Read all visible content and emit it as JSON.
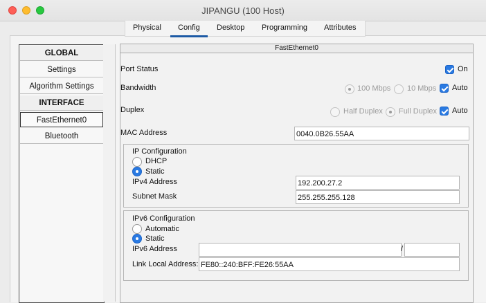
{
  "window": {
    "title": "JIPANGU (100 Host)"
  },
  "tabs": [
    {
      "label": "Physical"
    },
    {
      "label": "Config"
    },
    {
      "label": "Desktop"
    },
    {
      "label": "Programming"
    },
    {
      "label": "Attributes"
    }
  ],
  "active_tab": "Config",
  "nav": {
    "global_header": "GLOBAL",
    "settings": "Settings",
    "algorithm_settings": "Algorithm Settings",
    "interface_header": "INTERFACE",
    "fastethernet": "FastEthernet0",
    "bluetooth": "Bluetooth"
  },
  "panel": {
    "title": "FastEthernet0",
    "port_status_label": "Port Status",
    "port_status_on": "On",
    "bandwidth_label": "Bandwidth",
    "bw_100": "100 Mbps",
    "bw_10": "10 Mbps",
    "bw_auto": "Auto",
    "duplex_label": "Duplex",
    "half_duplex": "Half Duplex",
    "full_duplex": "Full Duplex",
    "duplex_auto": "Auto",
    "mac_label": "MAC Address",
    "mac_value": "0040.0B26.55AA"
  },
  "ipv4": {
    "title": "IP Configuration",
    "dhcp": "DHCP",
    "static": "Static",
    "address_label": "IPv4 Address",
    "address_value": "192.200.27.2",
    "mask_label": "Subnet Mask",
    "mask_value": "255.255.255.128"
  },
  "ipv6": {
    "title": "IPv6 Configuration",
    "automatic": "Automatic",
    "static": "Static",
    "address_label": "IPv6 Address",
    "address_value": "",
    "prefix_sep": "/",
    "prefix_value": "",
    "link_local_label": "Link Local Address:",
    "link_local_value": "FE80::240:BFF:FE26:55AA"
  },
  "colors": {
    "accent": "#2a7ae2",
    "tab_underline": "#1c5aa5"
  }
}
